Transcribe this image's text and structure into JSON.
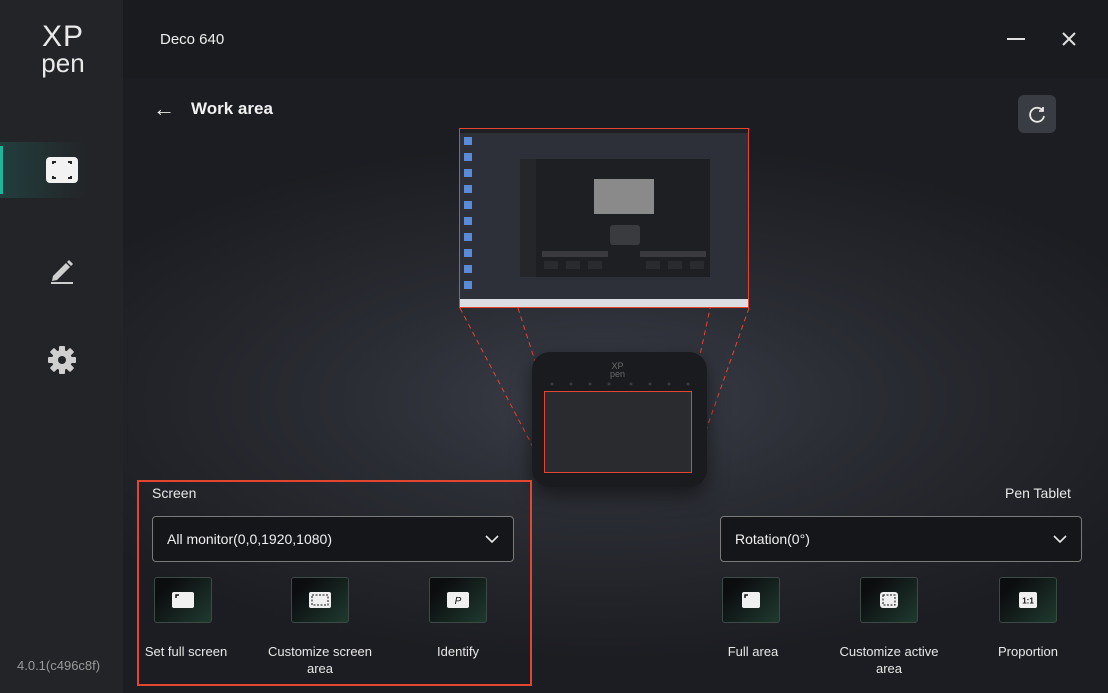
{
  "sidebar": {
    "logo_top": "XP",
    "logo_bottom": "pen",
    "items": [
      {
        "id": "work-area",
        "icon": "work-area-icon",
        "active": true
      },
      {
        "id": "pen",
        "icon": "pen-icon",
        "active": false
      },
      {
        "id": "settings",
        "icon": "gear-icon",
        "active": false
      }
    ],
    "version": "4.0.1(c496c8f)"
  },
  "titlebar": {
    "title": "Deco 640",
    "minimize_icon": "minimize-icon",
    "close_icon": "close-icon"
  },
  "page": {
    "back_arrow": "←",
    "title": "Work area",
    "refresh_icon": "refresh-icon"
  },
  "screen": {
    "label": "Screen",
    "selected": "All monitor(0,0,1920,1080)",
    "buttons": [
      {
        "label": "Set full screen",
        "icon": "full-screen-icon"
      },
      {
        "label": "Customize screen area",
        "icon": "customize-screen-icon"
      },
      {
        "label": "Identify",
        "icon": "identify-icon",
        "glyph": "P"
      }
    ]
  },
  "pen_tablet": {
    "label": "Pen Tablet",
    "selected": "Rotation(0°)",
    "buttons": [
      {
        "label": "Full area",
        "icon": "full-area-icon"
      },
      {
        "label": "Customize active area",
        "icon": "customize-active-area-icon"
      },
      {
        "label": "Proportion",
        "icon": "proportion-icon",
        "glyph": "1:1"
      }
    ]
  },
  "colors": {
    "accent": "#1fb59b",
    "highlight": "#e3452f",
    "background": "#1b1c20"
  }
}
